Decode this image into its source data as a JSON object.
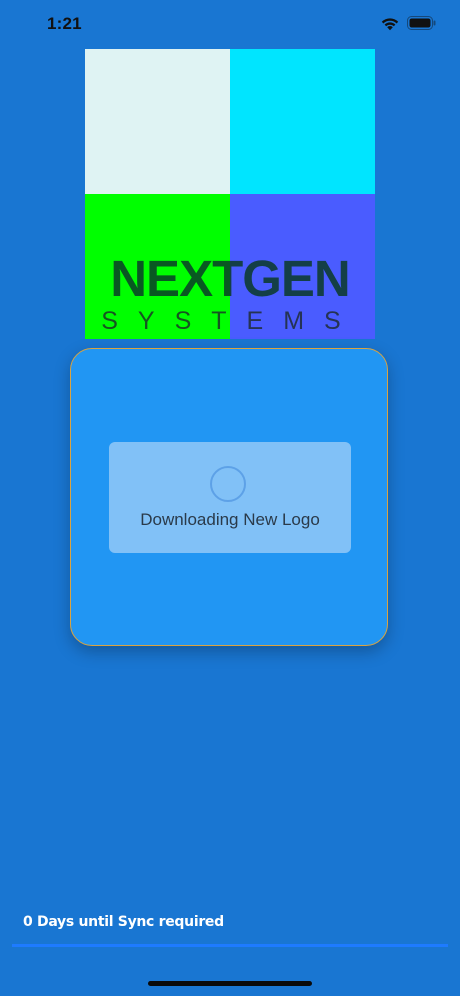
{
  "status_bar": {
    "time": "1:21",
    "icons": [
      "wifi-icon",
      "battery-icon"
    ]
  },
  "logo": {
    "word": "NEXTGEN",
    "sub": "SYSTEMS",
    "colors": {
      "top_left": "#dff3f3",
      "top_right": "#00e5ff",
      "bottom_left": "#00ff00",
      "bottom_right": "#4a5cff"
    }
  },
  "dialog": {
    "message": "Downloading New Logo",
    "loading": true
  },
  "footer": {
    "sync_text": "0 Days until Sync required"
  },
  "colors": {
    "background": "#1976d2",
    "card": "#2196f3",
    "card_border": "#d9a441",
    "sync_line": "#1e7bff"
  }
}
